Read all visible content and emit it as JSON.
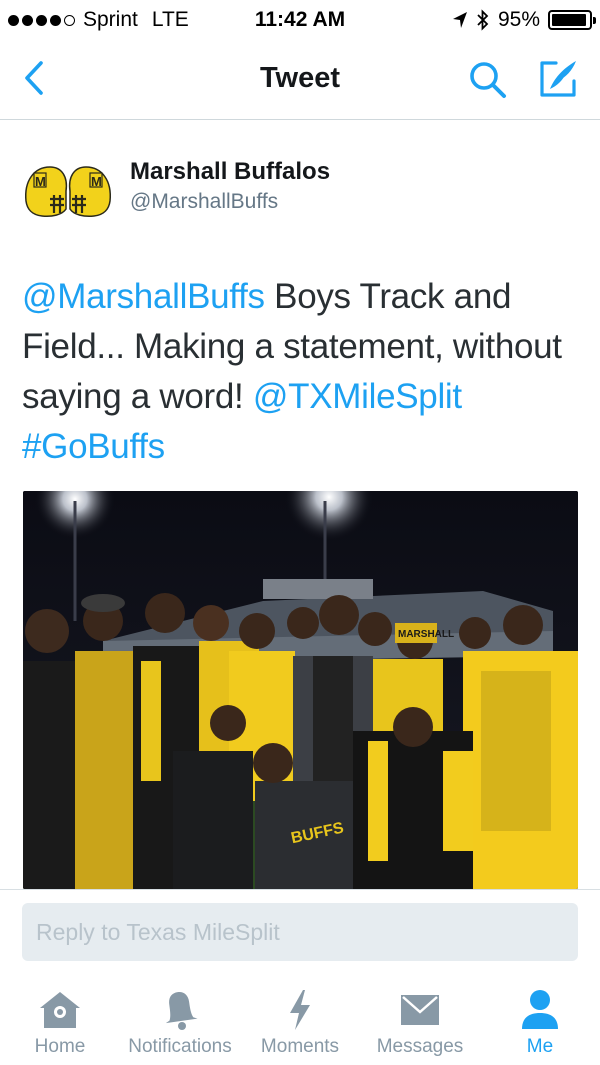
{
  "status_bar": {
    "carrier": "Sprint",
    "network": "LTE",
    "time": "11:42 AM",
    "battery_percent": "95%",
    "battery_level": 0.95,
    "signal_bars": 4
  },
  "nav": {
    "title": "Tweet",
    "back_icon": "chevron-left-icon",
    "search_icon": "search-icon",
    "compose_icon": "compose-icon"
  },
  "tweet": {
    "author_name": "Marshall Buffalos",
    "author_handle": "@MarshallBuffs",
    "text_segments": [
      {
        "text": "@MarshallBuffs",
        "link": true
      },
      {
        "text": " Boys Track and Field... Making a statement, without saying a word! ",
        "link": false
      },
      {
        "text": "@TXMileSplit",
        "link": true
      },
      {
        "text": " ",
        "link": false
      },
      {
        "text": "#GoBuffs",
        "link": true
      }
    ],
    "media_logo_text": "MARSHALL"
  },
  "reply": {
    "placeholder": "Reply to Texas MileSplit"
  },
  "tabs": [
    {
      "label": "Home",
      "icon": "home-icon",
      "active": false
    },
    {
      "label": "Notifications",
      "icon": "bell-icon",
      "active": false
    },
    {
      "label": "Moments",
      "icon": "lightning-icon",
      "active": false
    },
    {
      "label": "Messages",
      "icon": "envelope-icon",
      "active": false
    },
    {
      "label": "Me",
      "icon": "person-icon",
      "active": true
    }
  ],
  "colors": {
    "accent": "#1da1f2",
    "inactive": "#8899a6",
    "text": "#14171a",
    "muted": "#657786"
  }
}
